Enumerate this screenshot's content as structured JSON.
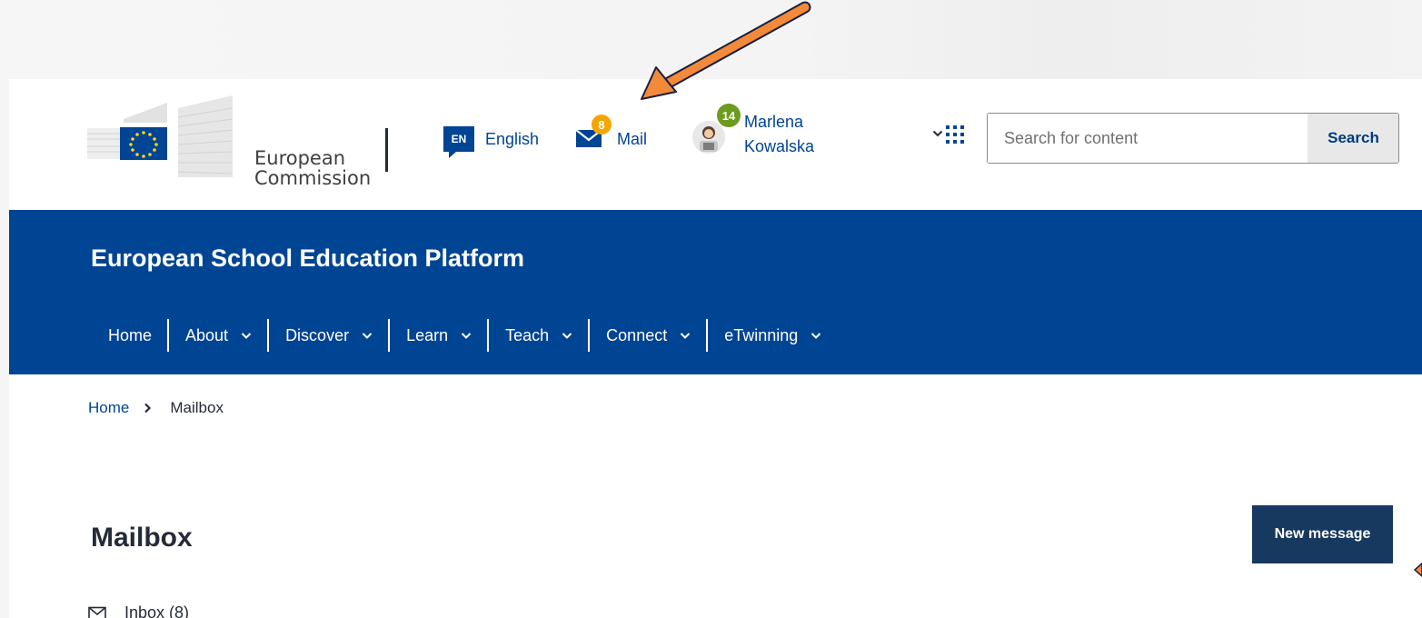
{
  "header": {
    "logo": {
      "line1": "European",
      "line2": "Commission"
    },
    "language": {
      "code": "EN",
      "label": "English"
    },
    "mail": {
      "label": "Mail",
      "count": "8"
    },
    "user": {
      "first_name": "Marlena",
      "last_name": "Kowalska",
      "notifications": "14"
    },
    "search": {
      "placeholder": "Search for content",
      "button_label": "Search"
    }
  },
  "banner": {
    "site_name": "European School Education Platform",
    "nav": [
      "Home",
      "About",
      "Discover",
      "Learn",
      "Teach",
      "Connect",
      "eTwinning"
    ]
  },
  "breadcrumb": {
    "home": "Home",
    "current": "Mailbox"
  },
  "main": {
    "title": "Mailbox",
    "new_message_label": "New message",
    "inbox_label": "Inbox (8)"
  },
  "colors": {
    "primary": "#004494",
    "mail_badge": "#f4a600",
    "user_badge": "#6c9b1f",
    "annotation_arrow": "#f28a3a",
    "button_dark": "#17385f"
  }
}
